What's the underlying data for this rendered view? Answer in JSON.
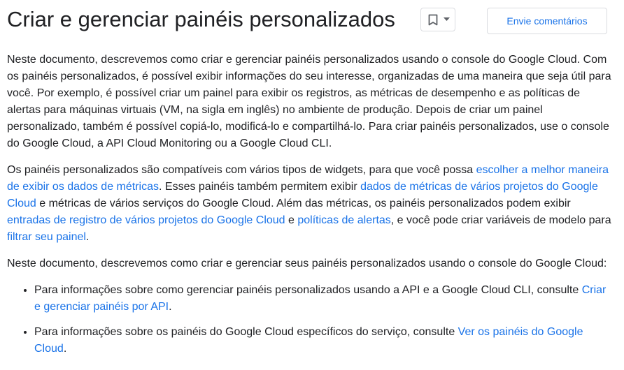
{
  "header": {
    "title": "Criar e gerenciar painéis personalizados",
    "bookmark_icon": "bookmark-icon",
    "dropdown_icon": "caret-down-icon",
    "feedback_label": "Envie comentários"
  },
  "colors": {
    "link": "#1a73e8",
    "text": "#202124",
    "border": "#dadce0"
  },
  "body": {
    "p1": "Neste documento, descrevemos como criar e gerenciar painéis personalizados usando o console do Google Cloud. Com os painéis personalizados, é possível exibir informações do seu interesse, organizadas de uma maneira que seja útil para você. Por exemplo, é possível criar um painel para exibir os registros, as métricas de desempenho e as políticas de alertas para máquinas virtuais (VM, na sigla em inglês) no ambiente de produção. Depois de criar um painel personalizado, também é possível copiá-lo, modificá-lo e compartilhá-lo. Para criar painéis personalizados, use o console do Google Cloud, a API Cloud Monitoring ou a Google Cloud CLI.",
    "p2": {
      "t1": "Os painéis personalizados são compatíveis com vários tipos de widgets, para que você possa ",
      "link1": "escolher a melhor maneira de exibir os dados de métricas",
      "t2": ". Esses painéis também permitem exibir ",
      "link2": "dados de métricas de vários projetos do Google Cloud",
      "t3": " e métricas de vários serviços do Google Cloud. Além das métricas, os painéis personalizados podem exibir ",
      "link3": "entradas de registro de vários projetos do Google Cloud",
      "t4": " e ",
      "link4": "políticas de alertas",
      "t5": ", e você pode criar variáveis de modelo para ",
      "link5": "filtrar seu painel",
      "t6": "."
    },
    "p3": "Neste documento, descrevemos como criar e gerenciar seus painéis personalizados usando o console do Google Cloud:",
    "bullets": [
      {
        "text": "Para informações sobre como gerenciar painéis personalizados usando a API e a Google Cloud CLI, consulte ",
        "link": "Criar e gerenciar painéis por API",
        "end": "."
      },
      {
        "text": "Para informações sobre os painéis do Google Cloud específicos do serviço, consulte ",
        "link": "Ver os painéis do Google Cloud",
        "end": "."
      }
    ]
  }
}
